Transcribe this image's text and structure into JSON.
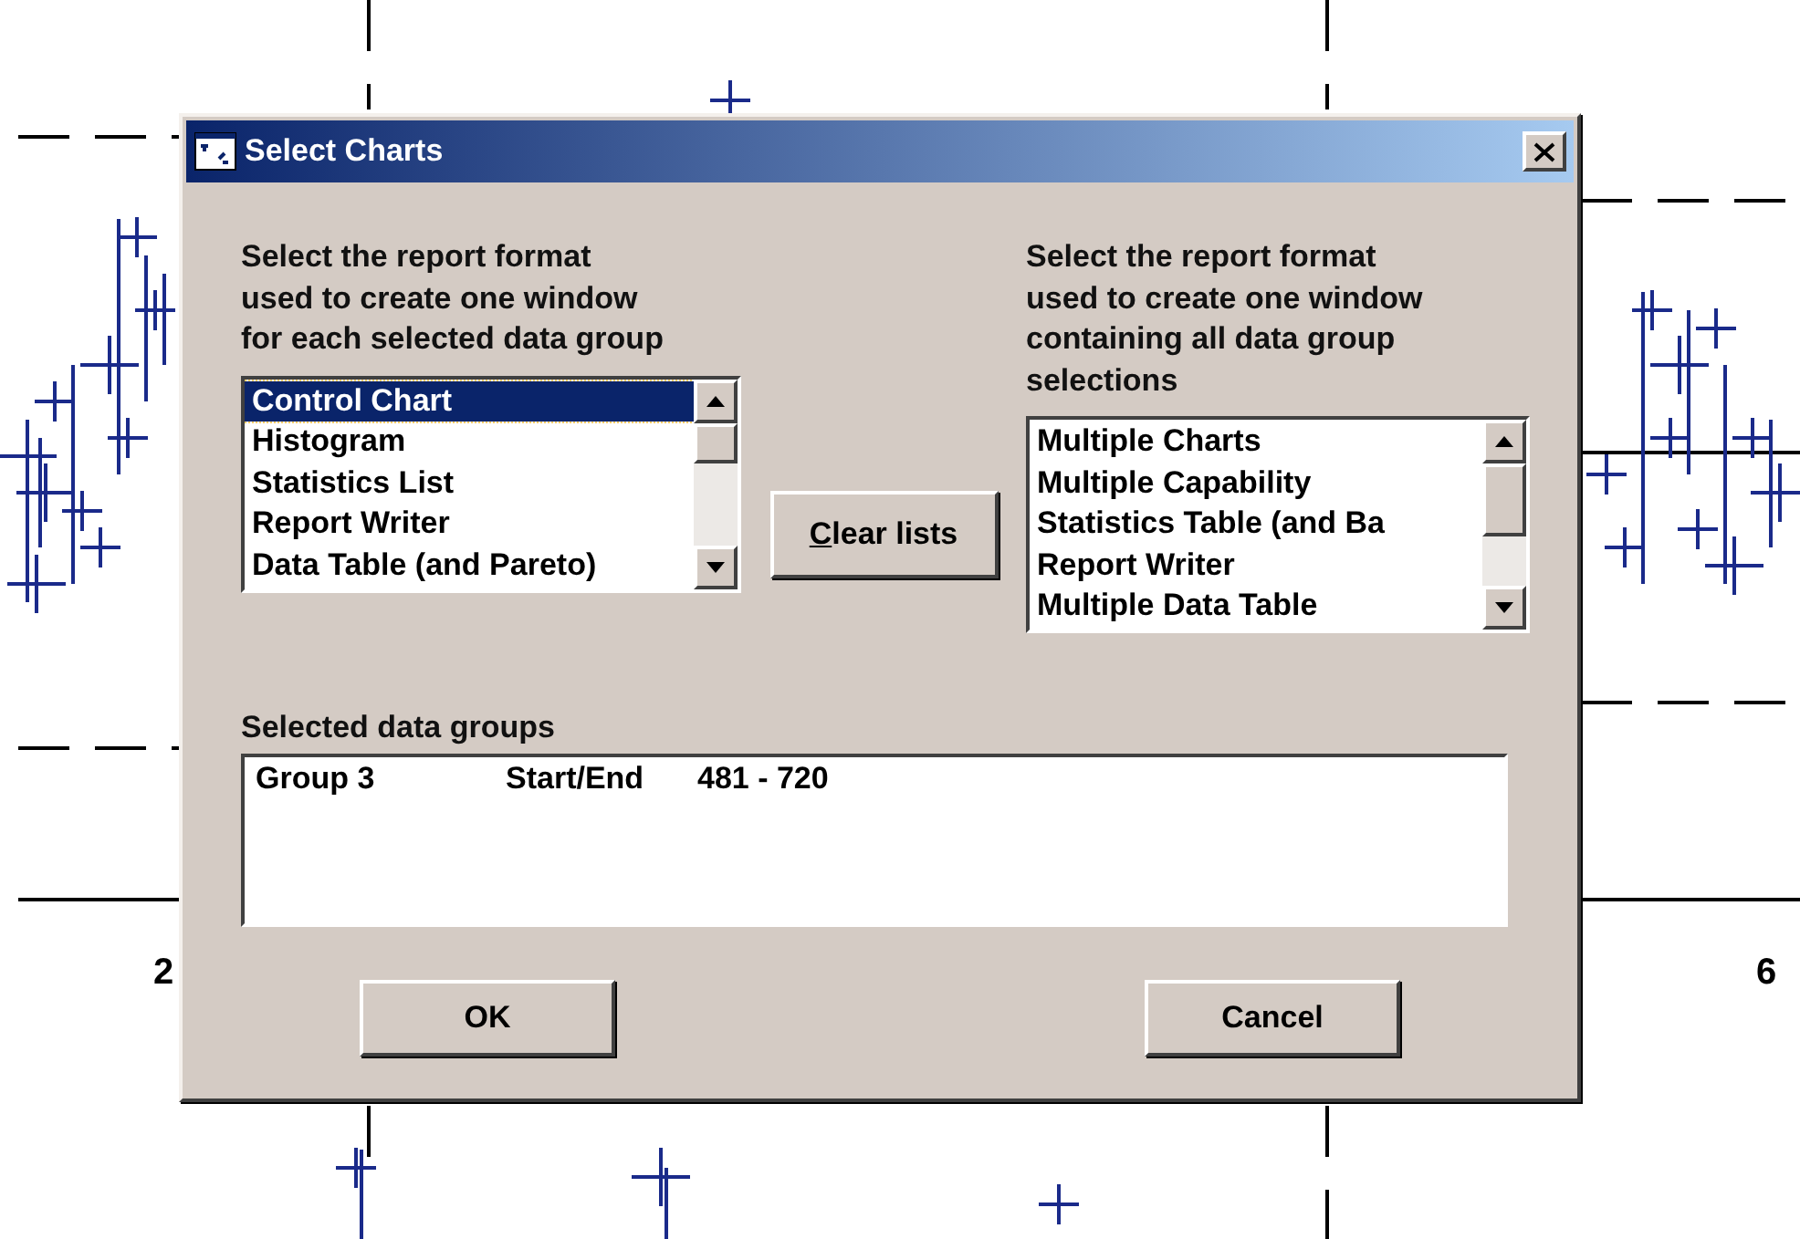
{
  "background": {
    "axis_labels": [
      "2",
      "6"
    ]
  },
  "window": {
    "title": "Select Charts"
  },
  "left_panel": {
    "description": "Select the report format used to create one window for each selected data group",
    "items": [
      {
        "label": "Control Chart",
        "selected": true
      },
      {
        "label": "Histogram",
        "selected": false
      },
      {
        "label": "Statistics List",
        "selected": false
      },
      {
        "label": "Report Writer",
        "selected": false
      },
      {
        "label": "Data Table (and Pareto)",
        "selected": false
      }
    ]
  },
  "clear_button": {
    "mnemonic": "C",
    "rest": "lear lists"
  },
  "right_panel": {
    "description": "Select the report format used to create one window containing all data group selections",
    "items": [
      {
        "label": "Multiple Charts",
        "selected": false
      },
      {
        "label": "Multiple Capability",
        "selected": false
      },
      {
        "label": "Statistics Table (and Ba",
        "selected": false
      },
      {
        "label": "Report Writer",
        "selected": false
      },
      {
        "label": "Multiple Data Table",
        "selected": false
      }
    ]
  },
  "selected_groups": {
    "label": "Selected data groups",
    "rows": [
      {
        "group": "Group 3",
        "range_label": "Start/End",
        "range": "481 - 720"
      }
    ]
  },
  "buttons": [
    "OK",
    "Cancel"
  ]
}
